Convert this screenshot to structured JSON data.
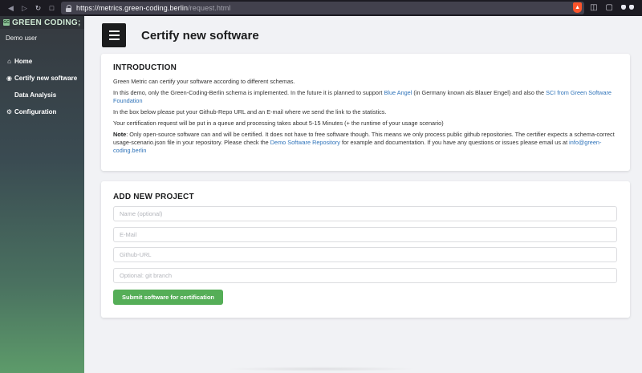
{
  "browser": {
    "url_host": "https://metrics.green-coding.berlin",
    "url_path": "/request.html",
    "nav_icons": [
      "sidebar-toggle-icon",
      "back-icon",
      "forward-icon",
      "reload-icon",
      "bookmark-icon"
    ]
  },
  "sidebar": {
    "logo_badge": "GC",
    "logo_text": "GREEN CODING;",
    "user": "Demo user",
    "items": [
      {
        "label": "Home",
        "icon": "home-icon"
      },
      {
        "label": "Certify new software",
        "icon": "certificate-icon"
      },
      {
        "label": "Data Analysis",
        "icon": ""
      },
      {
        "label": "Configuration",
        "icon": "cogs-icon"
      }
    ]
  },
  "header": {
    "title": "Certify new software"
  },
  "intro": {
    "heading": "INTRODUCTION",
    "p1": "Green Metric can certify your software according to different schemas.",
    "p2_a": "In this demo, only the Green-Coding-Berlin schema is implemented. In the future it is planned to support ",
    "p2_link1": "Blue Angel",
    "p2_b": " (in Germany known als Blauer Engel) and also the ",
    "p2_link2": "SCI from Green Software Foundation",
    "p3": "In the box below please put your Github-Repo URL and an E-mail where we send the link to the statistics.",
    "p4": "Your certification request will be put in a queue and processing takes about 5-15 Minutes (+ the runtime of your usage scenario)",
    "p5_label": "Note",
    "p5_a": ": Only open-source software can and will be certified. It does not have to free software though. This means we only process public github repositories. The certifier expects a schema-correct usage-scenario.json file in your repository. Please check the ",
    "p5_link1": "Demo Software Repository",
    "p5_b": " for example and documentation. If you have any questions or issues please email us at ",
    "p5_link2": "info@green-coding.berlin"
  },
  "form": {
    "heading": "ADD NEW PROJECT",
    "name_placeholder": "Name (optional)",
    "name_value": "",
    "email_placeholder": "E-Mail",
    "email_value": "",
    "github_placeholder": "Github-URL",
    "github_value": "",
    "branch_placeholder": "Optional: git branch",
    "branch_value": "",
    "submit_label": "Submit software for certification"
  },
  "colors": {
    "accent_green": "#55ae57",
    "link_blue": "#2f73b9",
    "sidebar_top": "#35393f",
    "sidebar_bottom": "#5d9b6a"
  }
}
